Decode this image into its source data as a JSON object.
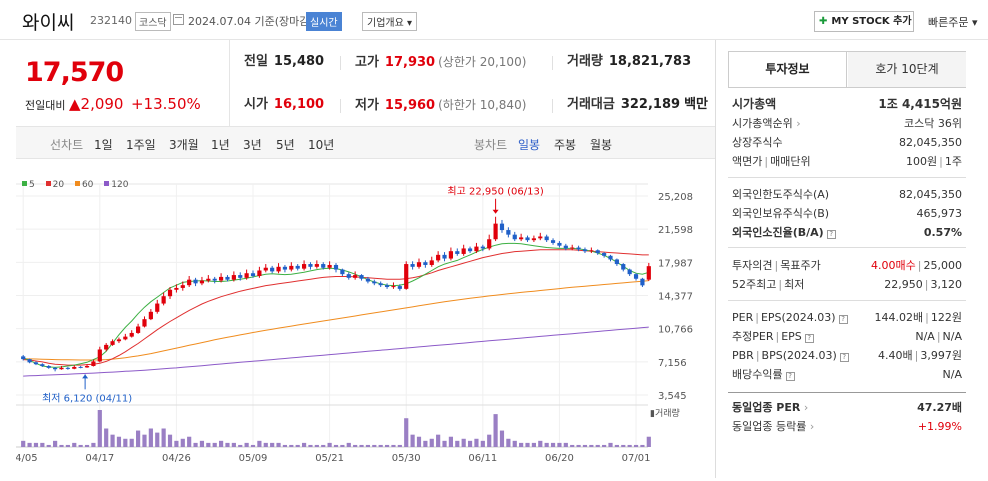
{
  "header": {
    "name": "와이씨",
    "code": "232140",
    "market": "코스닥",
    "date": "2024.07.04 기준(장마감)",
    "realtime": "실시간",
    "company_info": "기업개요",
    "mystock": "MY STOCK 추가",
    "quick_order": "빠른주문"
  },
  "price": {
    "current": "17,570",
    "change_label": "전일대비",
    "change": "2,090",
    "change_pct": "+13.50%"
  },
  "quote": {
    "prev_label": "전일",
    "prev": "15,480",
    "high_label": "고가",
    "high": "17,930",
    "upper_limit": "(상한가 20,100)",
    "volume_label": "거래량",
    "volume": "18,821,783",
    "open_label": "시가",
    "open": "16,100",
    "low_label": "저가",
    "low": "15,960",
    "lower_limit": "(하한가 10,840)",
    "amount_label": "거래대금",
    "amount": "322,189",
    "amount_unit": "백만"
  },
  "periods": {
    "line_label": "선차트",
    "line_items": [
      "1일",
      "1주일",
      "3개월",
      "1년",
      "3년",
      "5년",
      "10년"
    ],
    "candle_label": "봉차트",
    "candle_items": [
      "일봉",
      "주봉",
      "월봉"
    ]
  },
  "colors": {
    "ma5": "#3cb043",
    "ma20": "#e03030",
    "ma60": "#f08c1e",
    "ma120": "#8c5ac8",
    "up": "#e0000b",
    "down": "#2060c8",
    "volume": "#9a7fc4"
  },
  "chart_data": {
    "type": "candlestick",
    "legend": [
      "5",
      "20",
      "60",
      "120"
    ],
    "y_ticks": [
      "25,208",
      "21,598",
      "17,987",
      "14,377",
      "10,766",
      "7,156",
      "3,545"
    ],
    "ylim": [
      3545,
      25208
    ],
    "x_ticks": [
      "04/05",
      "04/17",
      "04/26",
      "05/09",
      "05/21",
      "05/30",
      "06/11",
      "06/20",
      "07/01"
    ],
    "x_tick_index": [
      0,
      12,
      24,
      36,
      48,
      60,
      72,
      84,
      96
    ],
    "high_annotation": "최고 22,950 (06/13)",
    "high_index": 74,
    "high_value": 22950,
    "low_annotation": "최저 6,120 (04/11)",
    "low_index": 5,
    "low_value": 6120,
    "volume_label": "거래량",
    "ma5": [
      7600,
      7300,
      7000,
      6700,
      6600,
      6550,
      6600,
      6700,
      6800,
      6950,
      7100,
      7400,
      7700,
      8300,
      9200,
      10100,
      10900,
      11600,
      12400,
      13100,
      13700,
      14200,
      14700,
      15200,
      15500,
      15800,
      15900,
      15950,
      16000,
      15950,
      15900,
      15900,
      15950,
      16050,
      16150,
      16250,
      16400,
      16550,
      16700,
      16750,
      16700,
      16650,
      16700,
      16800,
      16900,
      17050,
      17200,
      17300,
      17350,
      17300,
      17150,
      16950,
      16700,
      16400,
      16100,
      15850,
      15650,
      15500,
      15450,
      15500,
      15650,
      15950,
      16300,
      16700,
      17100,
      17500,
      17800,
      18000,
      18200,
      18500,
      18800,
      19100,
      19400,
      19650,
      19850,
      20000,
      20050,
      20050,
      20000,
      19900,
      19800,
      19700,
      19600,
      19550,
      19500,
      19500,
      19500,
      19450,
      19350,
      19200,
      19000,
      18750,
      18400,
      18000,
      17550,
      17100,
      16800,
      16700,
      16900
    ],
    "ma20": [
      7400,
      7350,
      7250,
      7150,
      7000,
      6900,
      6850,
      6800,
      6800,
      6800,
      6850,
      6900,
      7000,
      7200,
      7500,
      7850,
      8250,
      8700,
      9150,
      9650,
      10150,
      10650,
      11100,
      11550,
      11950,
      12350,
      12750,
      13100,
      13450,
      13750,
      14000,
      14250,
      14450,
      14650,
      14850,
      15000,
      15150,
      15300,
      15450,
      15550,
      15650,
      15750,
      15850,
      15950,
      16050,
      16150,
      16250,
      16350,
      16400,
      16450,
      16450,
      16450,
      16400,
      16350,
      16300,
      16250,
      16200,
      16150,
      16150,
      16150,
      16200,
      16300,
      16450,
      16650,
      16850,
      17100,
      17300,
      17500,
      17700,
      17900,
      18100,
      18300,
      18500,
      18650,
      18800,
      18950,
      19050,
      19150,
      19200,
      19250,
      19300,
      19350,
      19350,
      19350,
      19350,
      19350,
      19350,
      19300,
      19250,
      19200,
      19150,
      19100,
      19050,
      19000,
      18950,
      18900,
      18850,
      18800,
      18800
    ],
    "ma60": [
      7500,
      7480,
      7460,
      7440,
      7420,
      7400,
      7390,
      7380,
      7370,
      7360,
      7360,
      7360,
      7370,
      7400,
      7450,
      7520,
      7600,
      7700,
      7800,
      7920,
      8050,
      8200,
      8350,
      8500,
      8650,
      8800,
      8950,
      9100,
      9250,
      9400,
      9550,
      9700,
      9830,
      9960,
      10090,
      10220,
      10350,
      10470,
      10590,
      10710,
      10830,
      10940,
      11050,
      11160,
      11270,
      11380,
      11490,
      11600,
      11710,
      11820,
      11930,
      12040,
      12150,
      12260,
      12370,
      12480,
      12590,
      12700,
      12810,
      12920,
      13030,
      13140,
      13250,
      13360,
      13470,
      13580,
      13690,
      13790,
      13890,
      13980,
      14070,
      14160,
      14250,
      14330,
      14410,
      14490,
      14570,
      14640,
      14710,
      14780,
      14850,
      14920,
      14990,
      15060,
      15130,
      15200,
      15270,
      15330,
      15390,
      15450,
      15510,
      15570,
      15630,
      15690,
      15750,
      15810,
      15870,
      15930,
      16000
    ],
    "ma120": [
      5600,
      5630,
      5660,
      5690,
      5720,
      5750,
      5780,
      5810,
      5840,
      5870,
      5900,
      5930,
      5960,
      6000,
      6040,
      6080,
      6120,
      6160,
      6200,
      6250,
      6300,
      6350,
      6400,
      6450,
      6500,
      6560,
      6620,
      6680,
      6740,
      6800,
      6860,
      6920,
      6980,
      7040,
      7100,
      7160,
      7220,
      7280,
      7340,
      7400,
      7460,
      7520,
      7580,
      7640,
      7700,
      7760,
      7820,
      7880,
      7940,
      8000,
      8060,
      8120,
      8180,
      8240,
      8300,
      8360,
      8420,
      8480,
      8540,
      8600,
      8660,
      8720,
      8780,
      8840,
      8900,
      8960,
      9020,
      9080,
      9140,
      9200,
      9260,
      9320,
      9380,
      9440,
      9500,
      9560,
      9620,
      9680,
      9740,
      9800,
      9860,
      9920,
      9980,
      10040,
      10100,
      10160,
      10220,
      10280,
      10340,
      10400,
      10460,
      10520,
      10580,
      10640,
      10700,
      10760,
      10820,
      10880,
      10940
    ],
    "candles": [
      [
        7750,
        7450,
        7900,
        7300
      ],
      [
        7450,
        7100,
        7500,
        7000
      ],
      [
        7100,
        6900,
        7200,
        6800
      ],
      [
        6900,
        6700,
        7000,
        6600
      ],
      [
        6700,
        6500,
        6800,
        6400
      ],
      [
        6500,
        6350,
        6600,
        6120
      ],
      [
        6350,
        6500,
        6700,
        6300
      ],
      [
        6500,
        6400,
        6600,
        6300
      ],
      [
        6400,
        6600,
        6800,
        6350
      ],
      [
        6600,
        6550,
        6700,
        6450
      ],
      [
        6550,
        6700,
        6900,
        6500
      ],
      [
        6700,
        7200,
        7400,
        6650
      ],
      [
        7200,
        8500,
        8800,
        7100
      ],
      [
        8500,
        9000,
        9200,
        8300
      ],
      [
        9000,
        9400,
        9600,
        8900
      ],
      [
        9400,
        9600,
        9800,
        9200
      ],
      [
        9600,
        9900,
        10200,
        9500
      ],
      [
        9900,
        10300,
        10600,
        9800
      ],
      [
        10300,
        11000,
        11300,
        10200
      ],
      [
        11000,
        11800,
        12100,
        10900
      ],
      [
        11800,
        12600,
        12900,
        11700
      ],
      [
        12600,
        13500,
        13900,
        12400
      ],
      [
        13500,
        14300,
        14700,
        13300
      ],
      [
        14300,
        15000,
        15300,
        14000
      ],
      [
        15000,
        15200,
        15600,
        14700
      ],
      [
        15200,
        15500,
        15900,
        14900
      ],
      [
        15500,
        16100,
        16500,
        15300
      ],
      [
        16100,
        15700,
        16300,
        15400
      ],
      [
        15700,
        16000,
        16400,
        15500
      ],
      [
        16000,
        16200,
        16600,
        15800
      ],
      [
        16200,
        16000,
        16400,
        15700
      ],
      [
        16000,
        16400,
        16800,
        15800
      ],
      [
        16400,
        16100,
        16600,
        15900
      ],
      [
        16100,
        16600,
        17000,
        15900
      ],
      [
        16600,
        16300,
        16900,
        16000
      ],
      [
        16300,
        16800,
        17200,
        16100
      ],
      [
        16800,
        16500,
        17100,
        16300
      ],
      [
        16500,
        17100,
        17500,
        16300
      ],
      [
        17100,
        17400,
        17800,
        16900
      ],
      [
        17400,
        17000,
        17600,
        16800
      ],
      [
        17000,
        17500,
        17900,
        16800
      ],
      [
        17500,
        17200,
        17700,
        16900
      ],
      [
        17200,
        17600,
        18000,
        17000
      ],
      [
        17600,
        17300,
        17800,
        17100
      ],
      [
        17300,
        17800,
        18200,
        17100
      ],
      [
        17800,
        17500,
        18000,
        17200
      ],
      [
        17500,
        17800,
        18200,
        17300
      ],
      [
        17800,
        17400,
        18000,
        17200
      ],
      [
        17400,
        17700,
        18100,
        17200
      ],
      [
        17700,
        17200,
        17900,
        16900
      ],
      [
        17200,
        16700,
        17300,
        16500
      ],
      [
        16700,
        16300,
        16900,
        16100
      ],
      [
        16300,
        16600,
        17000,
        16100
      ],
      [
        16600,
        16200,
        16700,
        16000
      ],
      [
        16200,
        15900,
        16400,
        15700
      ],
      [
        15900,
        15700,
        16100,
        15500
      ],
      [
        15700,
        15500,
        15900,
        15300
      ],
      [
        15500,
        15300,
        15700,
        15100
      ],
      [
        15300,
        15400,
        15800,
        15100
      ],
      [
        15400,
        15100,
        15600,
        14900
      ],
      [
        15100,
        17800,
        18100,
        15000
      ],
      [
        17800,
        17500,
        18100,
        17200
      ],
      [
        17500,
        18000,
        18400,
        17300
      ],
      [
        18000,
        17700,
        18200,
        17400
      ],
      [
        17700,
        18200,
        18600,
        17500
      ],
      [
        18200,
        18800,
        19200,
        18000
      ],
      [
        18800,
        18400,
        19100,
        18100
      ],
      [
        18400,
        19200,
        19600,
        18200
      ],
      [
        19200,
        18900,
        19500,
        18700
      ],
      [
        18900,
        19500,
        19900,
        18700
      ],
      [
        19500,
        19200,
        19700,
        19000
      ],
      [
        19200,
        19700,
        20100,
        19000
      ],
      [
        19700,
        19500,
        19900,
        19200
      ],
      [
        19500,
        20500,
        21000,
        19300
      ],
      [
        20500,
        22200,
        22950,
        20300
      ],
      [
        22200,
        21500,
        22600,
        21200
      ],
      [
        21500,
        21000,
        21800,
        20700
      ],
      [
        21000,
        20500,
        21300,
        20300
      ],
      [
        20500,
        20700,
        21100,
        20300
      ],
      [
        20700,
        20400,
        20900,
        20200
      ],
      [
        20400,
        20600,
        20900,
        20200
      ],
      [
        20600,
        20800,
        21200,
        20400
      ],
      [
        20800,
        20400,
        21000,
        20200
      ],
      [
        20400,
        20100,
        20600,
        19900
      ],
      [
        20100,
        19800,
        20300,
        19600
      ],
      [
        19800,
        19500,
        20000,
        19300
      ],
      [
        19500,
        19600,
        19900,
        19300
      ],
      [
        19600,
        19400,
        19800,
        19200
      ],
      [
        19400,
        19200,
        19600,
        19000
      ],
      [
        19200,
        19300,
        19600,
        19000
      ],
      [
        19300,
        19000,
        19400,
        18800
      ],
      [
        19000,
        18700,
        19100,
        18500
      ],
      [
        18700,
        18300,
        18800,
        18100
      ],
      [
        18300,
        17800,
        18400,
        17600
      ],
      [
        17800,
        17200,
        17900,
        17000
      ],
      [
        17200,
        16700,
        17300,
        16500
      ],
      [
        16700,
        16200,
        16800,
        16000
      ],
      [
        16200,
        15480,
        16300,
        15300
      ],
      [
        16100,
        17570,
        17930,
        15960
      ]
    ],
    "volumes": [
      3,
      2,
      2,
      2,
      1,
      3,
      1,
      1,
      2,
      1,
      1,
      2,
      18,
      9,
      6,
      5,
      4,
      4,
      8,
      6,
      9,
      7,
      9,
      6,
      3,
      4,
      5,
      2,
      3,
      2,
      2,
      3,
      2,
      2,
      1,
      2,
      1,
      3,
      2,
      2,
      2,
      1,
      1,
      1,
      2,
      1,
      1,
      1,
      2,
      1,
      1,
      2,
      1,
      1,
      1,
      1,
      1,
      1,
      1,
      1,
      14,
      6,
      5,
      3,
      4,
      6,
      3,
      5,
      3,
      4,
      3,
      4,
      3,
      6,
      16,
      8,
      4,
      3,
      2,
      2,
      2,
      3,
      2,
      2,
      2,
      2,
      1,
      1,
      1,
      1,
      1,
      1,
      2,
      1,
      1,
      1,
      1,
      1,
      5
    ]
  },
  "panel": {
    "tab_active": "투자정보",
    "tab_other": "호가 10단계",
    "market_cap_label": "시가총액",
    "market_cap": "1조 4,415억원",
    "cap_rank_label": "시가총액순위",
    "cap_rank": "코스닥 36위",
    "shares_label": "상장주식수",
    "shares": "82,045,350",
    "par_label": "액면가",
    "unit_label": "매매단위",
    "par": "100원",
    "unit": "1주",
    "foreign_limit_label": "외국인한도주식수(A)",
    "foreign_limit": "82,045,350",
    "foreign_held_label": "외국인보유주식수(B)",
    "foreign_held": "465,973",
    "foreign_rate_label": "외국인소진율(B/A)",
    "foreign_rate": "0.57%",
    "opinion_label": "투자의견",
    "target_label": "목표주가",
    "opinion": "4.00매수",
    "target": "25,000",
    "w52_label": "52주최고",
    "w52_low_label": "최저",
    "w52_high": "22,950",
    "w52_low": "3,120",
    "per_label": "PER",
    "eps_label": "EPS(2024.03)",
    "per": "144.02배",
    "eps": "122원",
    "est_per_label": "추정PER",
    "est_eps_label": "EPS",
    "est_per": "N/A",
    "est_eps": "N/A",
    "pbr_label": "PBR",
    "bps_label": "BPS(2024.03)",
    "pbr": "4.40배",
    "bps": "3,997원",
    "div_label": "배당수익률",
    "div": "N/A",
    "sector_per_label": "동일업종 PER",
    "sector_per": "47.27배",
    "sector_rate_label": "동일업종 등락률",
    "sector_rate": "+1.99%"
  }
}
